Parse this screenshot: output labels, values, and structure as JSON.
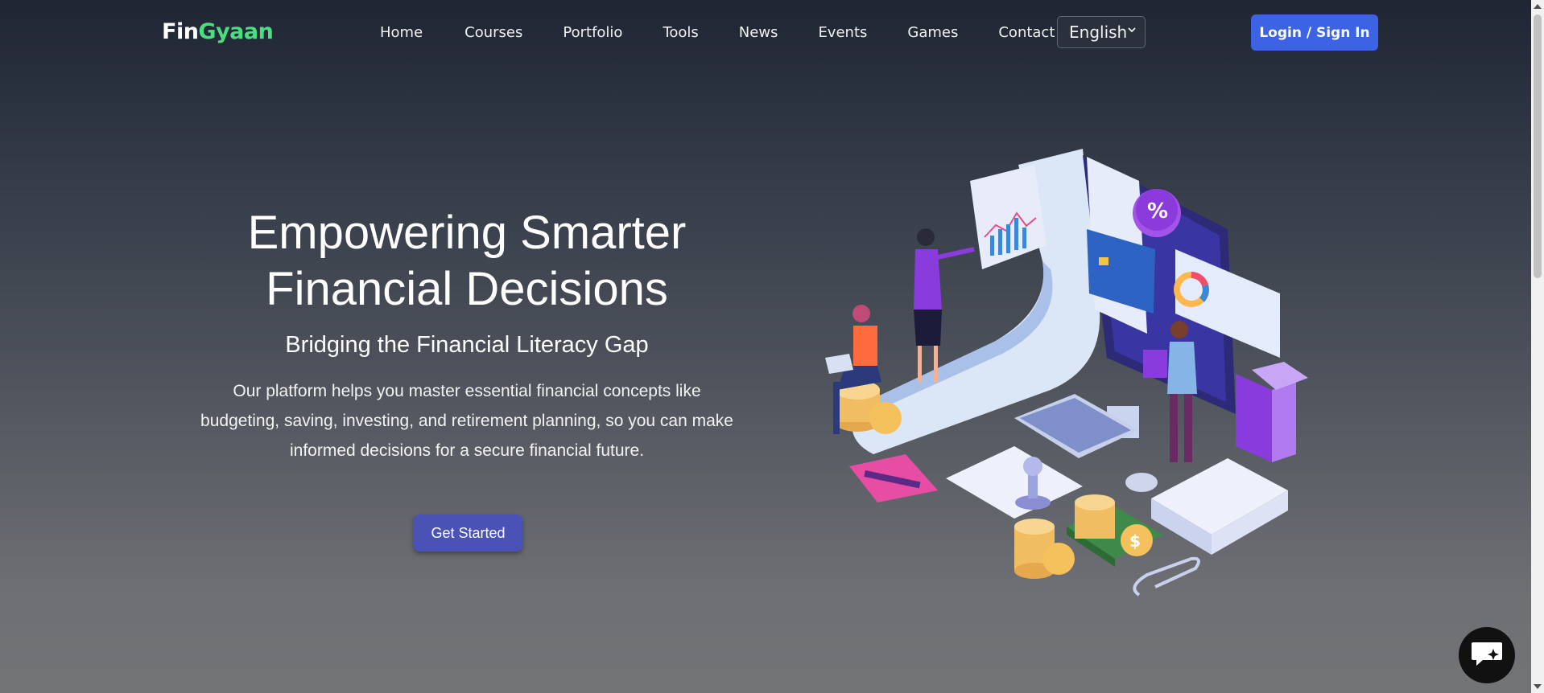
{
  "header": {
    "logo_part1": "Fin",
    "logo_part2": "Gyaan",
    "nav": [
      "Home",
      "Courses",
      "Portfolio",
      "Tools",
      "News",
      "Events",
      "Games",
      "Contact Us"
    ],
    "language": "English",
    "login_label": "Login / Sign In"
  },
  "hero": {
    "title_line1": "Empowering Smarter",
    "title_line2": "Financial Decisions",
    "subtitle": "Bridging the Financial Literacy Gap",
    "description": "Our platform helps you master essential financial concepts like budgeting, saving, investing, and retirement planning, so you can make informed decisions for a secure financial future.",
    "cta_label": "Get Started"
  },
  "colors": {
    "accent_green": "#4ade80",
    "login_blue": "#3b63e3",
    "cta_indigo": "#4b52b5"
  },
  "icons": {
    "chat": "chat-bubble-icon",
    "chevron": "chevron-down-icon"
  }
}
